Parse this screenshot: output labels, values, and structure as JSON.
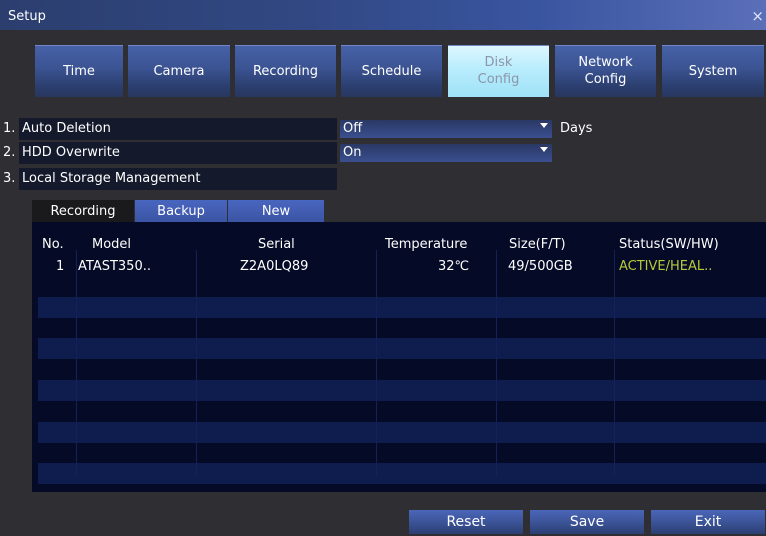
{
  "window": {
    "title": "Setup",
    "close": "×"
  },
  "tabs": [
    {
      "label": "Time"
    },
    {
      "label": "Camera"
    },
    {
      "label": "Recording"
    },
    {
      "label": "Schedule"
    },
    {
      "label": "Disk\nConfig",
      "active": true
    },
    {
      "label": "Network\nConfig"
    },
    {
      "label": "System"
    }
  ],
  "settings": {
    "auto_deletion": {
      "number": "1.",
      "label": "Auto Deletion",
      "value": "Off",
      "suffix": "Days"
    },
    "hdd_overwrite": {
      "number": "2.",
      "label": "HDD Overwrite",
      "value": "On"
    },
    "local_storage": {
      "number": "3.",
      "label": "Local Storage Management"
    }
  },
  "subtabs": {
    "recording": "Recording",
    "backup": "Backup",
    "new": "New"
  },
  "table": {
    "headers": {
      "no": "No.",
      "model": "Model",
      "serial": "Serial",
      "temperature": "Temperature",
      "size": "Size(F/T)",
      "status": "Status(SW/HW)"
    },
    "rows": [
      {
        "no": "1",
        "model": "ATAST350..",
        "serial": "Z2A0LQ89",
        "temperature": "32℃",
        "size": "49/500GB",
        "status": "ACTIVE/HEAL.."
      }
    ]
  },
  "buttons": {
    "reset": "Reset",
    "save": "Save",
    "exit": "Exit"
  },
  "colors": {
    "title_bar": "#314883",
    "active_tab": "#b9edfd",
    "table_bg": "#050a26",
    "status_ok": "#b7c93a"
  }
}
